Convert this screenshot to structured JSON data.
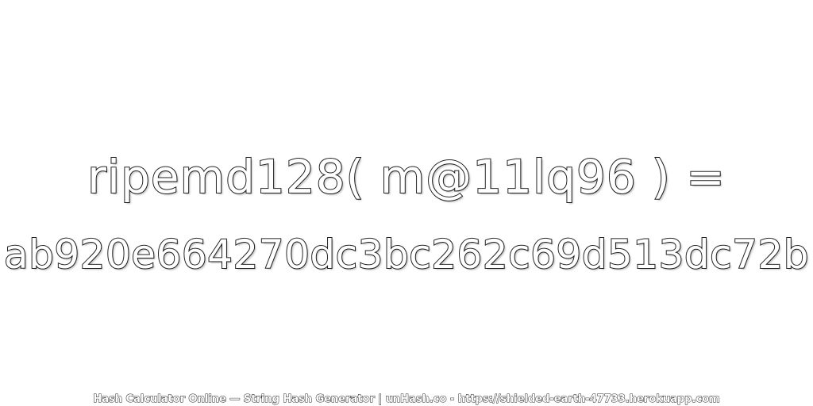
{
  "expression": "ripemd128( m@11lq96 ) =",
  "hash_value": "ab920e664270dc3bc262c69d513dc72b",
  "footer": "Hash Calculator Online — String Hash Generator | unHash.co - https://shielded-earth-47733.herokuapp.com",
  "colors": {
    "background": "#ffffff",
    "text_fill": "#ffffff",
    "text_outline": "#222222"
  }
}
